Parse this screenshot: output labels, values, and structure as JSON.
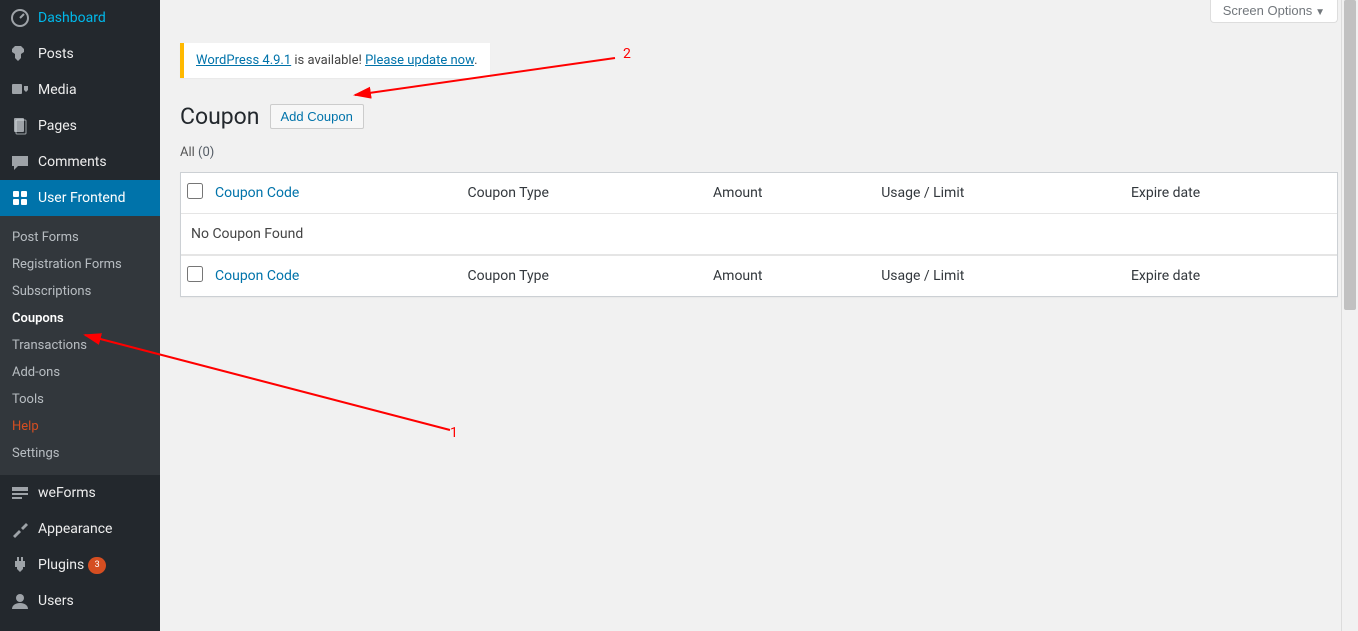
{
  "sidebar": {
    "main": [
      {
        "label": "Dashboard",
        "icon": "dashboard"
      },
      {
        "label": "Posts",
        "icon": "pin"
      },
      {
        "label": "Media",
        "icon": "media"
      },
      {
        "label": "Pages",
        "icon": "pages"
      },
      {
        "label": "Comments",
        "icon": "comments"
      },
      {
        "label": "User Frontend",
        "icon": "uf",
        "current": true
      },
      {
        "label": "weForms",
        "icon": "weforms"
      },
      {
        "label": "Appearance",
        "icon": "appearance"
      },
      {
        "label": "Plugins",
        "icon": "plugins",
        "badge": "3"
      },
      {
        "label": "Users",
        "icon": "users"
      }
    ],
    "submenu": [
      {
        "label": "Post Forms"
      },
      {
        "label": "Registration Forms"
      },
      {
        "label": "Subscriptions"
      },
      {
        "label": "Coupons",
        "active": true
      },
      {
        "label": "Transactions"
      },
      {
        "label": "Add-ons"
      },
      {
        "label": "Tools"
      },
      {
        "label": "Help",
        "help": true
      },
      {
        "label": "Settings"
      }
    ]
  },
  "screen_options": "Screen Options",
  "notice": {
    "link1": "WordPress 4.9.1",
    "mid": " is available! ",
    "link2": "Please update now",
    "tail": "."
  },
  "page_title": "Coupon",
  "add_button": "Add Coupon",
  "subsub": {
    "label": "All",
    "count": "(0)"
  },
  "columns": {
    "code": "Coupon Code",
    "type": "Coupon Type",
    "amount": "Amount",
    "usage": "Usage / Limit",
    "expire": "Expire date"
  },
  "empty_message": "No Coupon Found",
  "annotations": {
    "one": "1",
    "two": "2"
  }
}
